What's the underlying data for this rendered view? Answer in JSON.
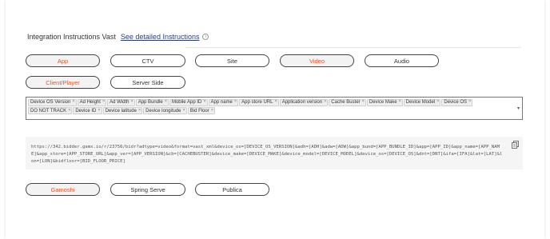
{
  "header": {
    "title": "Integration Instructions Vast",
    "link": "See detailed Instructions",
    "info_icon": "info-icon"
  },
  "format_pills": [
    {
      "label": "App",
      "active": true
    },
    {
      "label": "CTV",
      "active": false
    },
    {
      "label": "Site",
      "active": false
    },
    {
      "label": "Video",
      "active": true
    },
    {
      "label": "Audio",
      "active": false
    }
  ],
  "integration_pills": [
    {
      "label": "Client/Player",
      "active": true
    },
    {
      "label": "Server Side",
      "active": false
    }
  ],
  "macros": [
    "Device OS Version",
    "Ad Height",
    "Ad Width",
    "App Bundle",
    "Mobile App ID",
    "App name",
    "App store URL",
    "Application version",
    "Cache Buster",
    "Device Make",
    "Device Model",
    "Device OS",
    "DO NOT TRACK",
    "Device ID",
    "Device latitude",
    "Device longitude",
    "Bid Floor"
  ],
  "tag_remove_glyph": "×",
  "dropdown_glyph": "▾",
  "url": "https://342.bidder.gamx.io/r/23756/bidr?adtype=video&format=vast_xml&device_os=[DEVICE_OS_VERSION]&adh=[ADH]&adw=[ADW]&app_bund=[APP_BUNDLE_ID]&app=[APP_ID]&app_name=[APP_NAME]&app_store=[APP_STORE_URL]&app_ver=[APP_VERSION]&cb=[CACHEBUSTER]&device_make=[DEVICE_MAKE]&device_model=[DEVICE_MODEL]&device_os=[DEVICE_OS]&dnt=[DNT]&ifa=[IFA]&lat=[LAT]&lon=[LON]&bidfloor=[BID_FLOOR_PRICE]",
  "copy_icon": "copy-icon",
  "partner_pills": [
    {
      "label": "Gamoshi",
      "active": true
    },
    {
      "label": "Spring Serve",
      "active": false
    },
    {
      "label": "Publica",
      "active": false
    }
  ],
  "colors": {
    "accent": "#e8562a",
    "link": "#2c3e7a",
    "active_bg": "#f3f3f3"
  }
}
